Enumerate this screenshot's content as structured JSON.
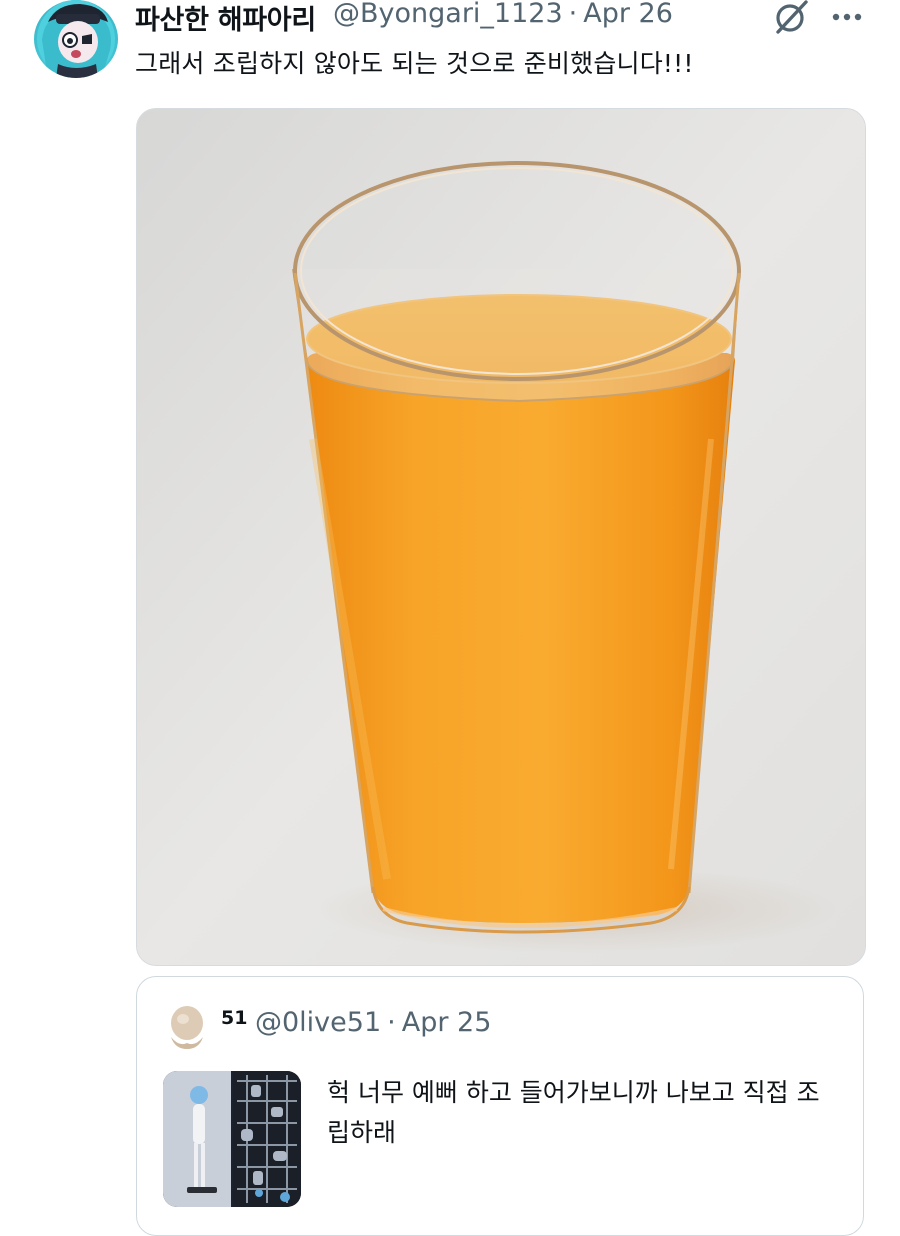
{
  "tweet": {
    "display_name": "파산한 해파아리",
    "handle": "@Byongari_1123",
    "separator": "·",
    "date": "Apr 26",
    "text": "그래서 조립하지 않아도 되는 것으로 준비했습니다!!!",
    "avatar_icon": "anime-character-avatar",
    "grok_icon": "grok-icon",
    "more_icon": "more-options-icon",
    "media_description_icon": "orange-juice-glass-photo"
  },
  "quote": {
    "display_name": "51",
    "handle": "@0live51",
    "separator": "·",
    "date": "Apr 25",
    "text": "헉 너무 예뻐 하고 들어가보니까 나보고 직접 조립하래",
    "avatar_icon": "egg-figure-avatar",
    "thumbnail_icon": "figure-kit-thumbnail"
  },
  "colors": {
    "text_primary": "#0f1419",
    "text_secondary": "#536471",
    "border": "#cfd9de",
    "juice_orange": "#f39a1c"
  }
}
